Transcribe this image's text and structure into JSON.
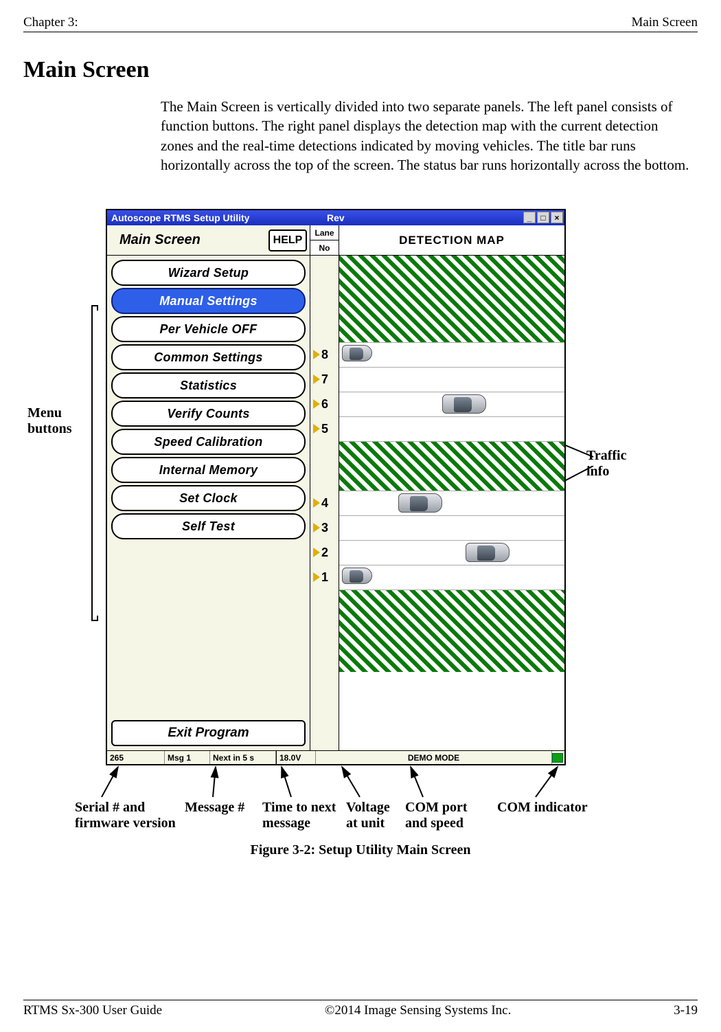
{
  "header": {
    "chapter": "Chapter 3:",
    "section": "Main Screen"
  },
  "h_title": "Main Screen",
  "body_text": "The Main Screen is vertically divided into two separate panels. The left panel consists of function buttons. The right panel displays the detection map with the current detection zones and the real-time detections indicated by moving vehicles. The title bar runs horizontally across the top of the screen. The status bar runs horizontally across the bottom.",
  "titlebar": {
    "app": "Autoscope RTMS Setup Utility",
    "rev": "Rev"
  },
  "left": {
    "title": "Main Screen",
    "help": "HELP",
    "buttons": [
      "Wizard Setup",
      "Manual Settings",
      "Per Vehicle OFF",
      "Common Settings",
      "Statistics",
      "Verify Counts",
      "Speed Calibration",
      "Internal Memory",
      "Set Clock",
      "Self Test"
    ],
    "selected_index": 1,
    "exit": "Exit Program"
  },
  "right": {
    "lane": "Lane",
    "no": "No",
    "title": "DETECTION MAP",
    "lane_numbers": [
      "8",
      "7",
      "6",
      "5",
      "4",
      "3",
      "2",
      "1"
    ]
  },
  "status": {
    "serial": "265",
    "msg": "Msg 1",
    "next": "Next in 5 s",
    "volt": "18.0V",
    "mode": "DEMO MODE"
  },
  "annotations": {
    "menu_buttons": "Menu\nbuttons",
    "traffic_info": "Traffic\ninfo",
    "serial": "Serial # and\nfirmware version",
    "msg": "Message #",
    "next": "Time to next\nmessage",
    "volt": "Voltage\nat unit",
    "com": "COM port\nand speed",
    "ind": "COM indicator"
  },
  "figure_caption": "Figure 3-2: Setup Utility Main Screen",
  "footer": {
    "left": "RTMS Sx-300 User Guide",
    "center": "©2014 Image Sensing Systems Inc.",
    "right": "3-19"
  }
}
